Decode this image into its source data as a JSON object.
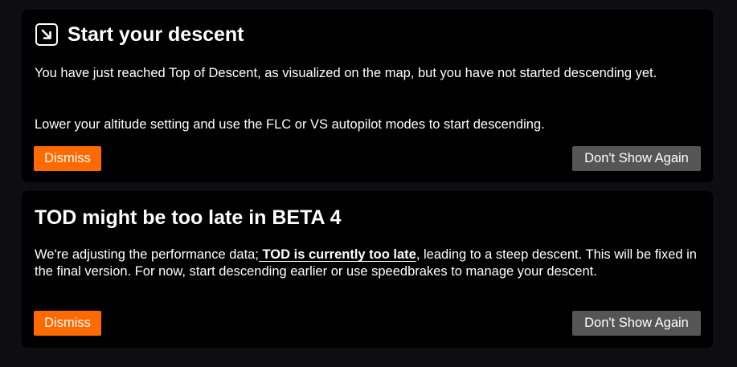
{
  "notifications": [
    {
      "title": "Start your descent",
      "icon": "arrow-down-right-icon",
      "paragraph1": "You have just reached Top of Descent, as visualized on the map, but you have not started descending yet.",
      "paragraph2": "Lower your altitude setting and use the FLC or VS autopilot modes to start descending.",
      "dismiss_label": "Dismiss",
      "hide_label": "Don't Show Again"
    },
    {
      "title": "TOD might be too late in BETA 4",
      "text_before": "We're adjusting the performance data;",
      "text_highlight": " TOD is currently too late",
      "text_after": ", leading to a steep descent. This will be fixed in the final version. For now, start descending earlier or use speedbrakes to manage your descent.",
      "dismiss_label": "Dismiss",
      "hide_label": "Don't Show Again"
    }
  ],
  "colors": {
    "background": "#0e0e12",
    "card": "#000000",
    "dismiss": "#ff6a00",
    "secondary": "#555555",
    "text": "#ffffff"
  }
}
